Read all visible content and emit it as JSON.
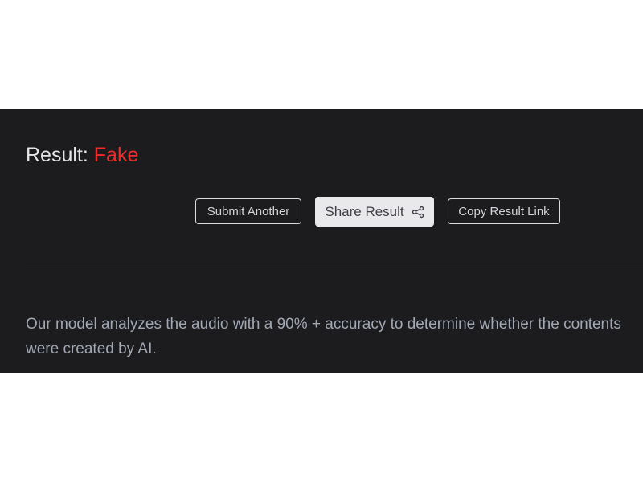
{
  "result": {
    "label": "Result: ",
    "value": "Fake",
    "value_color": "#ef2b2b"
  },
  "actions": {
    "submit_another": "Submit Another",
    "share_result": "Share Result",
    "share_icon": "share-icon",
    "copy_result_link": "Copy Result Link"
  },
  "description": "Our model analyzes the audio with a 90% + accuracy to determine whether the contents were created by AI."
}
